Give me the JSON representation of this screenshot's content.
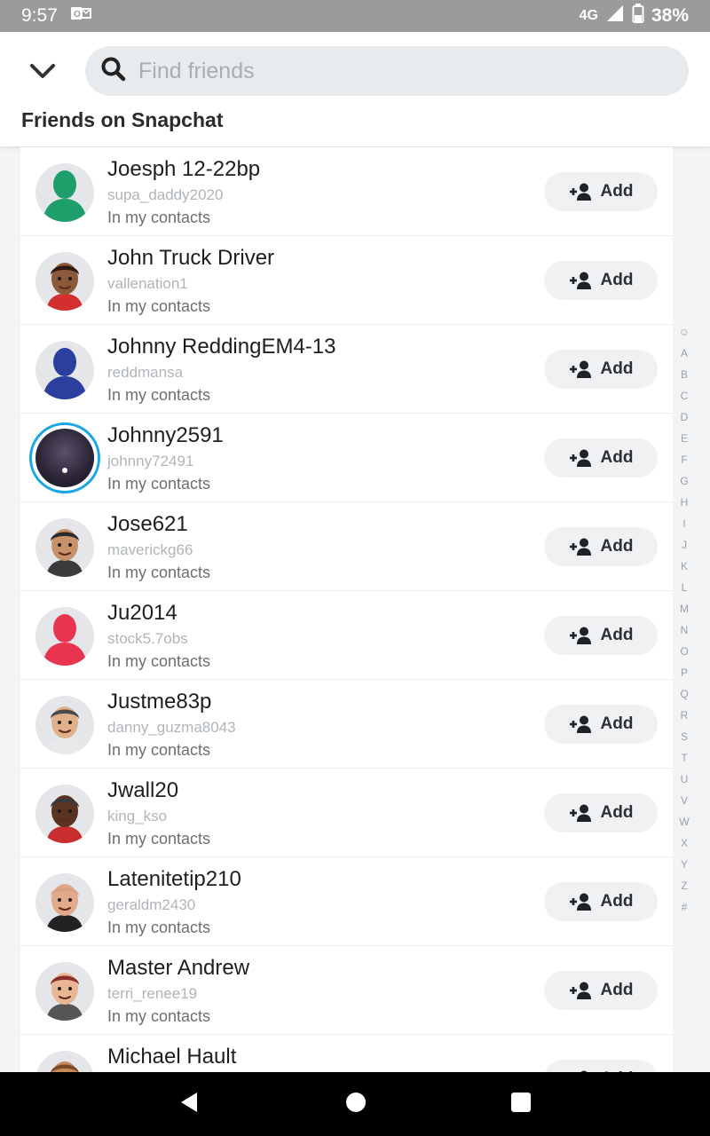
{
  "status_bar": {
    "time": "9:57",
    "network": "4G",
    "battery": "38%"
  },
  "header": {
    "back_icon": "chevron-down-icon",
    "search_placeholder": "Find friends",
    "section_title": "Friends on Snapchat"
  },
  "friends": [
    {
      "name": "Joesph 12-22bp",
      "username": "supa_daddy2020",
      "subtext": "In my contacts",
      "avatar": "silhouette",
      "color": "#1e9e6a",
      "add_label": "Add"
    },
    {
      "name": "John Truck Driver",
      "username": "vallenation1",
      "subtext": "In my contacts",
      "avatar": "bitmoji",
      "skin": "#8a5a3a",
      "hair": "#2a1a10",
      "shirt": "#d42f2f",
      "add_label": "Add"
    },
    {
      "name": "Johnny ReddingEM4-13",
      "username": "reddmansa",
      "subtext": "In my contacts",
      "avatar": "silhouette",
      "color": "#2a3f9e",
      "add_label": "Add"
    },
    {
      "name": "Johnny2591",
      "username": "johnny72491",
      "subtext": "In my contacts",
      "avatar": "story",
      "add_label": "Add"
    },
    {
      "name": "Jose621",
      "username": "maverickg66",
      "subtext": "In my contacts",
      "avatar": "bitmoji",
      "skin": "#c8916a",
      "hair": "#2b2b2b",
      "shirt": "#3b3b3b",
      "add_label": "Add"
    },
    {
      "name": "Ju2014",
      "username": "stock5.7obs",
      "subtext": "In my contacts",
      "avatar": "silhouette",
      "color": "#e8344e",
      "add_label": "Add"
    },
    {
      "name": "Justme83p",
      "username": "danny_guzma8043",
      "subtext": "In my contacts",
      "avatar": "bitmoji",
      "skin": "#e0b08a",
      "hair": "#4a4a4a",
      "shirt": "#e9e9e9",
      "add_label": "Add"
    },
    {
      "name": "Jwall20",
      "username": "king_kso",
      "subtext": "In my contacts",
      "avatar": "bitmoji",
      "skin": "#5a3422",
      "hair": "#3a3a3a",
      "shirt": "#c92e2e",
      "add_label": "Add"
    },
    {
      "name": "Latenitetip210",
      "username": "geraldm2430",
      "subtext": "In my contacts",
      "avatar": "bitmoji",
      "skin": "#e2a98a",
      "hair": "#d9a184",
      "shirt": "#222222",
      "add_label": "Add"
    },
    {
      "name": "Master Andrew",
      "username": "terri_renee19",
      "subtext": "In my contacts",
      "avatar": "bitmoji",
      "skin": "#e8b692",
      "hair": "#8e2b2b",
      "shirt": "#555555",
      "add_label": "Add"
    },
    {
      "name": "Michael Hault",
      "username": "",
      "subtext": "",
      "avatar": "bitmoji",
      "skin": "#c78a5a",
      "hair": "#7a4a2a",
      "shirt": "#555555",
      "add_label": "Add"
    }
  ],
  "alphabet_index": [
    "☺",
    "A",
    "B",
    "C",
    "D",
    "E",
    "F",
    "G",
    "H",
    "I",
    "J",
    "K",
    "L",
    "M",
    "N",
    "O",
    "P",
    "Q",
    "R",
    "S",
    "T",
    "U",
    "V",
    "W",
    "X",
    "Y",
    "Z",
    "#"
  ],
  "nav_bar": {
    "back": "back-triangle-icon",
    "home": "home-circle-icon",
    "recents": "recents-square-icon"
  }
}
